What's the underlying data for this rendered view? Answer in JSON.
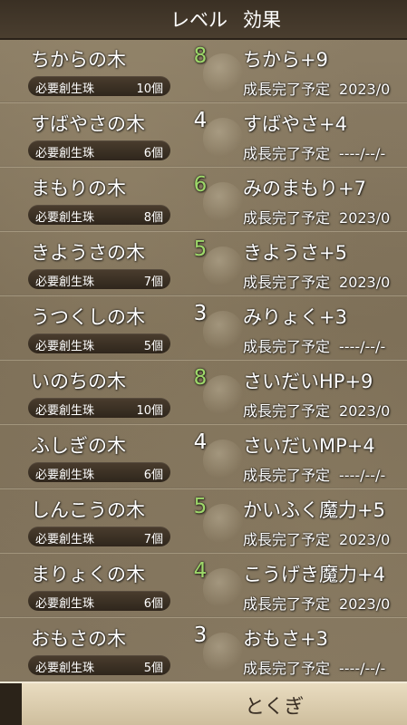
{
  "header": {
    "level_label": "レベル",
    "effect_label": "効果"
  },
  "cost_label": "必要創生珠",
  "growth_label": "成長完了予定",
  "trees": [
    {
      "name": "ちからの木",
      "level": "8",
      "max": true,
      "cost": "10個",
      "effect": "ちから+9",
      "date": "2023/0"
    },
    {
      "name": "すばやさの木",
      "level": "4",
      "max": false,
      "cost": "6個",
      "effect": "すばやさ+4",
      "date": "----/--/-"
    },
    {
      "name": "まもりの木",
      "level": "6",
      "max": true,
      "cost": "8個",
      "effect": "みのまもり+7",
      "date": "2023/0"
    },
    {
      "name": "きようさの木",
      "level": "5",
      "max": true,
      "cost": "7個",
      "effect": "きようさ+5",
      "date": "2023/0"
    },
    {
      "name": "うつくしの木",
      "level": "3",
      "max": false,
      "cost": "5個",
      "effect": "みりょく+3",
      "date": "----/--/-"
    },
    {
      "name": "いのちの木",
      "level": "8",
      "max": true,
      "cost": "10個",
      "effect": "さいだいHP+9",
      "date": "2023/0"
    },
    {
      "name": "ふしぎの木",
      "level": "4",
      "max": false,
      "cost": "6個",
      "effect": "さいだいMP+4",
      "date": "----/--/-"
    },
    {
      "name": "しんこうの木",
      "level": "5",
      "max": true,
      "cost": "7個",
      "effect": "かいふく魔力+5",
      "date": "2023/0"
    },
    {
      "name": "まりょくの木",
      "level": "4",
      "max": true,
      "cost": "6個",
      "effect": "こうげき魔力+4",
      "date": "2023/0"
    },
    {
      "name": "おもさの木",
      "level": "3",
      "max": false,
      "cost": "5個",
      "effect": "おもさ+3",
      "date": "----/--/-"
    }
  ],
  "bottom": {
    "label": "とくぎ"
  },
  "colors": {
    "max_level": "#9ed86a",
    "text": "#ffffff",
    "pill": "#2f261c"
  }
}
